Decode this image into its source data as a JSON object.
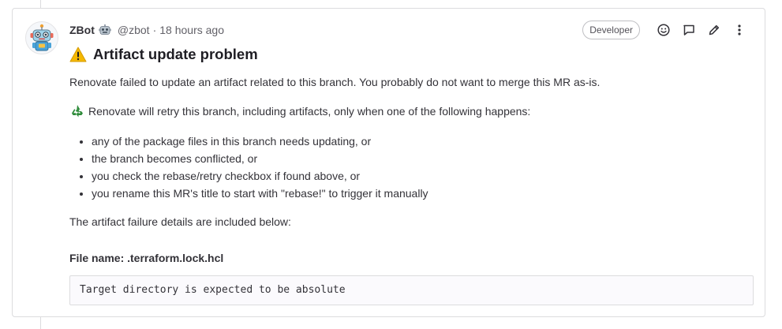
{
  "note": {
    "author": {
      "name": "ZBot",
      "bot_icon": "robot-face-icon",
      "handle": "@zbot",
      "separator": "·",
      "timestamp": "18 hours ago",
      "avatar_icon": "robot-avatar-icon"
    },
    "role_badge": "Developer",
    "actions": [
      {
        "name": "add-reaction-button",
        "icon": "smiley-icon"
      },
      {
        "name": "reply-button",
        "icon": "comment-icon"
      },
      {
        "name": "edit-button",
        "icon": "pencil-icon"
      },
      {
        "name": "more-actions-button",
        "icon": "kebab-icon"
      }
    ],
    "title": "Artifact update problem",
    "title_icon": "warning-emoji-icon",
    "intro": "Renovate failed to update an artifact related to this branch. You probably do not want to merge this MR as-is.",
    "retry_icon": "recycle-emoji-icon",
    "retry_text": "Renovate will retry this branch, including artifacts, only when one of the following happens:",
    "conditions": [
      "any of the package files in this branch needs updating, or",
      "the branch becomes conflicted, or",
      "you check the rebase/retry checkbox if found above, or",
      "you rename this MR's title to start with \"rebase!\" to trigger it manually"
    ],
    "details_text": "The artifact failure details are included below:",
    "file_name": "File name: .terraform.lock.hcl",
    "code": "Target directory is expected to be absolute"
  },
  "colors": {
    "border": "#dcdcde",
    "text": "#333238",
    "muted": "#626168",
    "warning": "#f5b800",
    "recycle": "#2e8b3a"
  }
}
